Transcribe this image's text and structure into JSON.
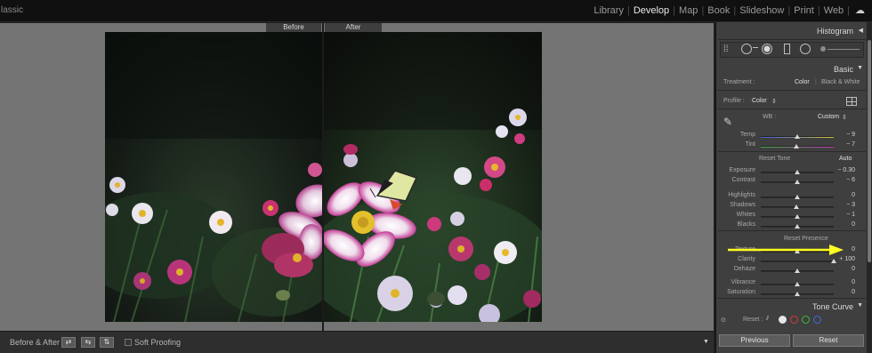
{
  "app": {
    "title": "lassic"
  },
  "modules": {
    "items": [
      "Library",
      "Develop",
      "Map",
      "Book",
      "Slideshow",
      "Print",
      "Web"
    ],
    "active": "Develop",
    "cloud_icon": "cloud-icon"
  },
  "view": {
    "before_label": "Before",
    "after_label": "After"
  },
  "toolbar": {
    "before_after_label": "Before & After :",
    "soft_proofing_label": "Soft Proofing",
    "menu_arrow": "▼"
  },
  "panel": {
    "histogram_title": "Histogram",
    "basic_title": "Basic",
    "treatment_label": "Treatment :",
    "treatment_color": "Color",
    "treatment_bw": "Black & White",
    "profile_label": "Profile :",
    "profile_value": "Color",
    "wb_label": "WB :",
    "wb_value": "Custom",
    "reset_tone": "Reset Tone",
    "auto": "Auto",
    "reset_presence": "Reset Presence",
    "tone_curve_title": "Tone Curve",
    "reset_label": "Reset :",
    "previous_button": "Previous",
    "reset_button": "Reset",
    "sliders": {
      "temp": {
        "label": "Temp",
        "value": "− 9",
        "pos": 0.5
      },
      "tint": {
        "label": "Tint",
        "value": "− 7",
        "pos": 0.49
      },
      "exposure": {
        "label": "Exposure",
        "value": "− 0.30",
        "pos": 0.5
      },
      "contrast": {
        "label": "Contrast",
        "value": "− 6",
        "pos": 0.5
      },
      "highlights": {
        "label": "Highlights",
        "value": "0",
        "pos": 0.5
      },
      "shadows": {
        "label": "Shadows",
        "value": "− 3",
        "pos": 0.49
      },
      "whites": {
        "label": "Whites",
        "value": "− 1",
        "pos": 0.5
      },
      "blacks": {
        "label": "Blacks",
        "value": "0",
        "pos": 0.5
      },
      "texture": {
        "label": "Texture",
        "value": "0",
        "pos": 0.5
      },
      "clarity": {
        "label": "Clarity",
        "value": "+ 100",
        "pos": 1.0
      },
      "dehaze": {
        "label": "Dehaze",
        "value": "0",
        "pos": 0.5
      },
      "vibrance": {
        "label": "Vibrance",
        "value": "0",
        "pos": 0.5
      },
      "saturation": {
        "label": "Saturation",
        "value": "0",
        "pos": 0.5
      }
    }
  },
  "colors": {
    "annotation_arrow": "#ffff22",
    "temp_start": "#3b5bd9",
    "temp_end": "#d6c23a",
    "tint_start": "#3fae3f",
    "tint_end": "#c23ac2"
  }
}
